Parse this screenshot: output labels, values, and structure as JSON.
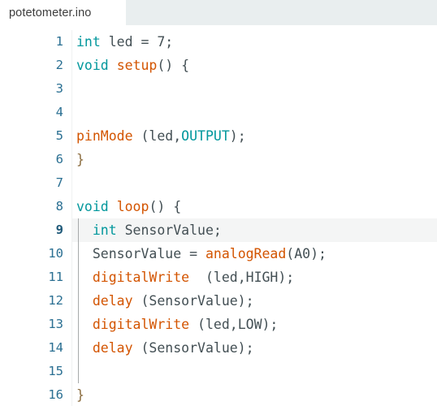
{
  "window": {
    "title": "potetometer.ino"
  },
  "tabbar": {
    "tabs": [
      {
        "label": "potetometer.ino",
        "active": true
      }
    ]
  },
  "colors": {
    "keyword": "#00979C",
    "function": "#D35400",
    "plain": "#434F54",
    "line_number": "#2A6F92",
    "active_line_bg": "#F4F5F5",
    "tabstrip_bg": "#E9EEEF",
    "editor_bg": "#FFFFFF",
    "indent_guide": "#A7AAAB"
  },
  "editor": {
    "active_line": 9,
    "lines": [
      {
        "n": "1",
        "text": "int led = 7;"
      },
      {
        "n": "2",
        "text": "void setup() {"
      },
      {
        "n": "3",
        "text": ""
      },
      {
        "n": "4",
        "text": ""
      },
      {
        "n": "5",
        "text": "pinMode (led,OUTPUT);"
      },
      {
        "n": "6",
        "text": "}"
      },
      {
        "n": "7",
        "text": ""
      },
      {
        "n": "8",
        "text": "void loop() {"
      },
      {
        "n": "9",
        "text": "  int SensorValue;"
      },
      {
        "n": "10",
        "text": "  SensorValue = analogRead(A0);"
      },
      {
        "n": "11",
        "text": "  digitalWrite  (led,HIGH);"
      },
      {
        "n": "12",
        "text": "  delay (SensorValue);"
      },
      {
        "n": "13",
        "text": "  digitalWrite (led,LOW);"
      },
      {
        "n": "14",
        "text": "  delay (SensorValue);"
      },
      {
        "n": "15",
        "text": ""
      },
      {
        "n": "16",
        "text": "}"
      }
    ],
    "tokens": {
      "l1": [
        [
          "int",
          "kw"
        ],
        [
          " led = 7;",
          "pl"
        ]
      ],
      "l2": [
        [
          "void",
          "kw"
        ],
        [
          " ",
          "pl"
        ],
        [
          "setup",
          "fn"
        ],
        [
          "() {",
          "pl"
        ]
      ],
      "l5": [
        [
          "pinMode",
          "fn"
        ],
        [
          " (led,",
          "pl"
        ],
        [
          "OUTPUT",
          "kw"
        ],
        [
          ");",
          "pl"
        ]
      ],
      "l6": [
        [
          "}",
          "br"
        ]
      ],
      "l8": [
        [
          "void",
          "kw"
        ],
        [
          " ",
          "pl"
        ],
        [
          "loop",
          "fn"
        ],
        [
          "() {",
          "pl"
        ]
      ],
      "l9": [
        [
          "  ",
          "pl"
        ],
        [
          "int",
          "kw"
        ],
        [
          " SensorValue;",
          "pl"
        ]
      ],
      "l10": [
        [
          "  SensorValue = ",
          "pl"
        ],
        [
          "analogRead",
          "fn"
        ],
        [
          "(A0);",
          "pl"
        ]
      ],
      "l11": [
        [
          "  ",
          "pl"
        ],
        [
          "digitalWrite",
          "fn"
        ],
        [
          "  (led,HIGH);",
          "pl"
        ]
      ],
      "l12": [
        [
          "  ",
          "pl"
        ],
        [
          "delay",
          "fn"
        ],
        [
          " (SensorValue);",
          "pl"
        ]
      ],
      "l13": [
        [
          "  ",
          "pl"
        ],
        [
          "digitalWrite",
          "fn"
        ],
        [
          " (led,LOW);",
          "pl"
        ]
      ],
      "l14": [
        [
          "  ",
          "pl"
        ],
        [
          "delay",
          "fn"
        ],
        [
          " (SensorValue);",
          "pl"
        ]
      ],
      "l16": [
        [
          "}",
          "br"
        ]
      ]
    }
  }
}
